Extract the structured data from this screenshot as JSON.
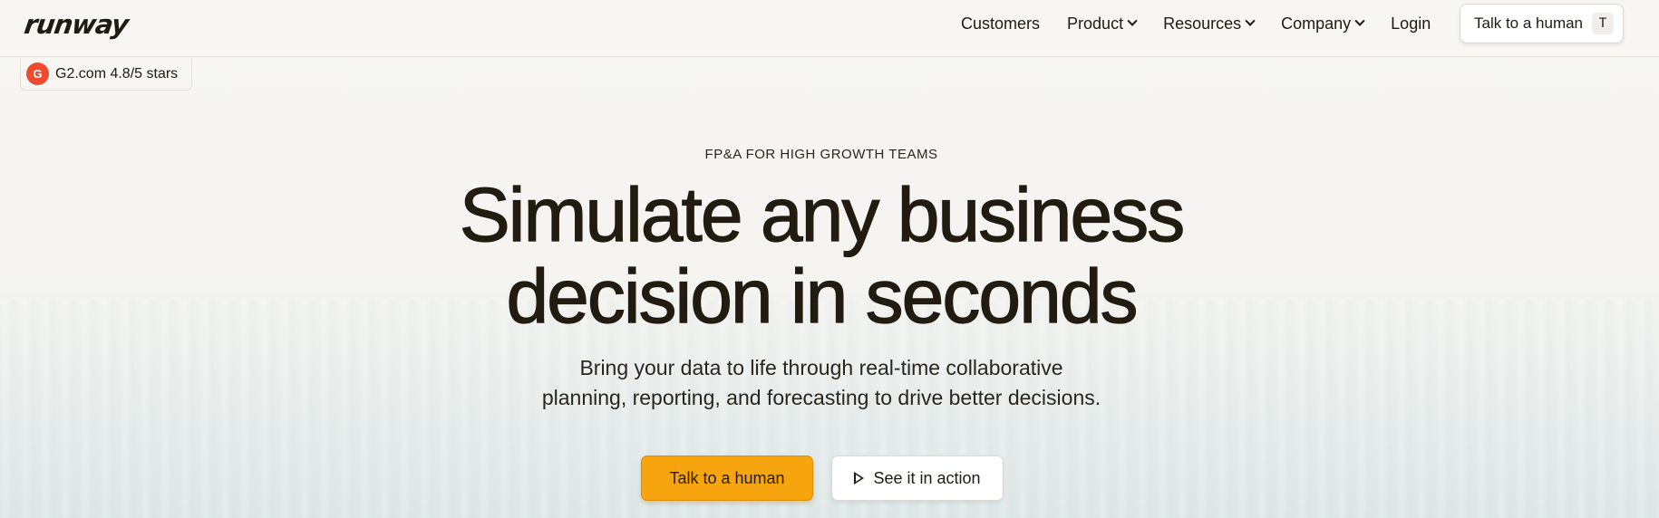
{
  "brand": {
    "logo_text": "runway"
  },
  "nav": {
    "items": [
      {
        "label": "Customers",
        "has_dropdown": false
      },
      {
        "label": "Product",
        "has_dropdown": true
      },
      {
        "label": "Resources",
        "has_dropdown": true
      },
      {
        "label": "Company",
        "has_dropdown": true
      },
      {
        "label": "Login",
        "has_dropdown": false
      }
    ],
    "cta_label": "Talk to a human",
    "cta_shortcut": "T"
  },
  "badge": {
    "icon_text": "G",
    "text": "G2.com 4.8/5 stars"
  },
  "hero": {
    "eyebrow": "FP&A FOR HIGH GROWTH TEAMS",
    "title_line1": "Simulate any business",
    "title_line2": "decision in seconds",
    "subtitle_line1": "Bring your data to life through real-time collaborative",
    "subtitle_line2": "planning, reporting, and forecasting to drive better decisions.",
    "primary_button": "Talk to a human",
    "secondary_button": "See it in action"
  },
  "colors": {
    "accent": "#f6a50f",
    "g2_red": "#ef4a2f",
    "text": "#1f1a12"
  }
}
